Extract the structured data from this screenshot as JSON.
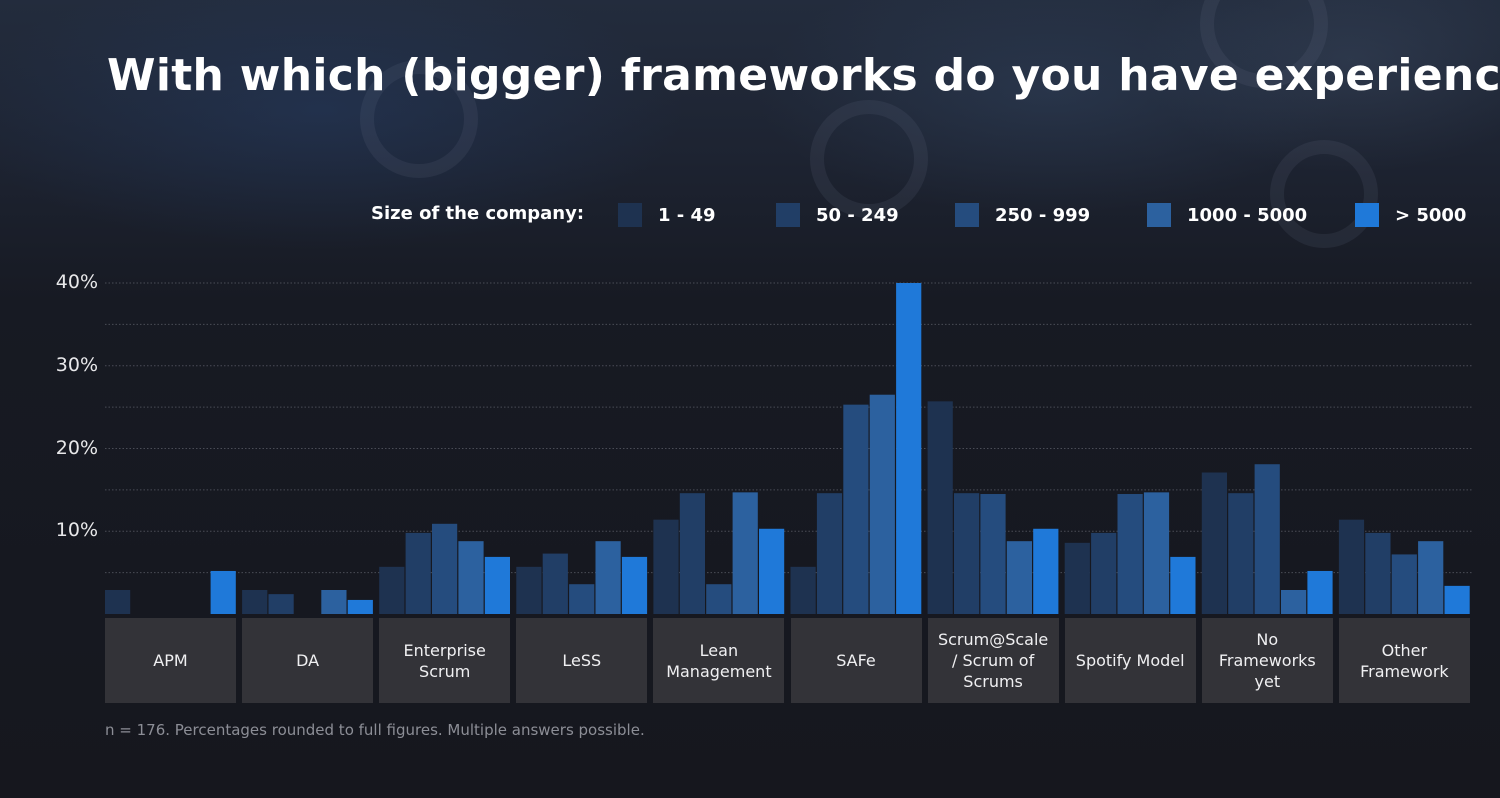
{
  "title": "With which (bigger) frameworks do you have experience?",
  "legend": {
    "label": "Size of the company:",
    "items": [
      {
        "name": "1 - 49",
        "color": "#1e3250"
      },
      {
        "name": "50 - 249",
        "color": "#213e66"
      },
      {
        "name": "250 - 999",
        "color": "#254c7e"
      },
      {
        "name": "1000 - 5000",
        "color": "#2c619f"
      },
      {
        "name": "> 5000",
        "color": "#1f79d9"
      }
    ]
  },
  "footnote": "n = 176. Percentages rounded to full figures. Multiple answers possible.",
  "chart_data": {
    "type": "bar",
    "title": "With which (bigger) frameworks do you have experience?",
    "xlabel": "",
    "ylabel": "",
    "ylim": [
      0,
      40
    ],
    "yticks": [
      10,
      20,
      30,
      40
    ],
    "ytick_labels": [
      "10%",
      "20%",
      "30%",
      "40%"
    ],
    "grid": true,
    "grid_step": 5,
    "legend_title": "Size of the company:",
    "legend_position": "top-right",
    "categories": [
      "APM",
      "DA",
      "Enterprise\nScrum",
      "LeSS",
      "Lean\nManagement",
      "SAFe",
      "Scrum@Scale\n/ Scrum of\nScrums",
      "Spotify Model",
      "No\nFrameworks\nyet",
      "Other\nFramework"
    ],
    "series": [
      {
        "name": "1 - 49",
        "color": "#1e3250",
        "values": [
          2.9,
          2.9,
          5.7,
          5.7,
          11.4,
          5.7,
          25.7,
          8.6,
          17.1,
          11.4
        ]
      },
      {
        "name": "50 - 249",
        "color": "#213e66",
        "values": [
          0,
          2.4,
          9.8,
          7.3,
          14.6,
          14.6,
          14.6,
          9.8,
          14.6,
          9.8
        ]
      },
      {
        "name": "250 - 999",
        "color": "#254c7e",
        "values": [
          0,
          0,
          10.9,
          3.6,
          3.6,
          25.3,
          14.5,
          14.5,
          18.1,
          7.2
        ]
      },
      {
        "name": "1000 - 5000",
        "color": "#2c619f",
        "values": [
          0,
          2.9,
          8.8,
          8.8,
          14.7,
          26.5,
          8.8,
          14.7,
          2.9,
          8.8
        ]
      },
      {
        "name": "> 5000",
        "color": "#1f79d9",
        "values": [
          5.2,
          1.7,
          6.9,
          6.9,
          10.3,
          40.0,
          10.3,
          6.9,
          5.2,
          3.4
        ]
      }
    ]
  }
}
